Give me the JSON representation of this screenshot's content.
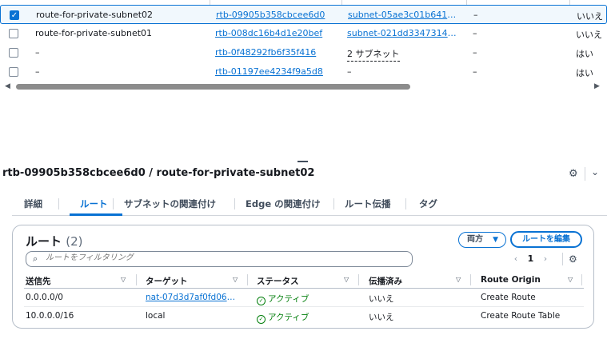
{
  "route_tables": [
    {
      "name": "route-for-private-subnet02",
      "rtb_id": "rtb-09905b358cbcee6d0",
      "subnet": "subnet-05ae3c01b6410e…",
      "subnet_style": "link",
      "edge": "–",
      "main": "いいえ",
      "selected": true
    },
    {
      "name": "route-for-private-subnet01",
      "rtb_id": "rtb-008dc16b4d1e20bef",
      "subnet": "subnet-021dd334731431…",
      "subnet_style": "link",
      "edge": "–",
      "main": "いいえ",
      "selected": false
    },
    {
      "name": "–",
      "rtb_id": "rtb-0f48292fb6f35f416",
      "subnet": "2 サブネット",
      "subnet_style": "dashed",
      "edge": "–",
      "main": "はい",
      "selected": false
    },
    {
      "name": "–",
      "rtb_id": "rtb-01197ee4234f9a5d8",
      "subnet": "–",
      "subnet_style": "plain",
      "edge": "–",
      "main": "はい",
      "selected": false
    }
  ],
  "detail": {
    "title": "rtb-09905b358cbcee6d0 / route-for-private-subnet02",
    "tabs": [
      "詳細",
      "ルート",
      "サブネットの関連付け",
      "Edge の関連付け",
      "ルート伝播",
      "タグ"
    ],
    "active_tab": "ルート"
  },
  "routes_panel": {
    "title": "ルート",
    "count": "(2)",
    "both_button": "両方",
    "edit_button": "ルートを編集",
    "search_placeholder": "ルートをフィルタリング",
    "page": "1",
    "columns": [
      "送信先",
      "ターゲット",
      "ステータス",
      "伝播済み",
      "Route Origin"
    ],
    "rows": [
      {
        "destination": "0.0.0.0/0",
        "target": "nat-07d3d7af0fd069…",
        "target_link": true,
        "status": "アクティブ",
        "propagated": "いいえ",
        "origin": "Create Route"
      },
      {
        "destination": "10.0.0.0/16",
        "target": "local",
        "target_link": false,
        "status": "アクティブ",
        "propagated": "いいえ",
        "origin": "Create Route Table"
      }
    ]
  },
  "icons": {
    "checkbox_checked": "check-icon",
    "scroll_left": "triangle-left-icon",
    "scroll_right": "triangle-right-icon",
    "settings": "gear-icon",
    "collapse": "chevron-down-icon",
    "search": "search-icon",
    "status_ok": "check-circle-icon",
    "sort": "caret-down-icon"
  },
  "colors": {
    "accent": "#0972d3",
    "success": "#037f0c",
    "text": "#16191f",
    "selected_bg": "#f1f8fd"
  }
}
